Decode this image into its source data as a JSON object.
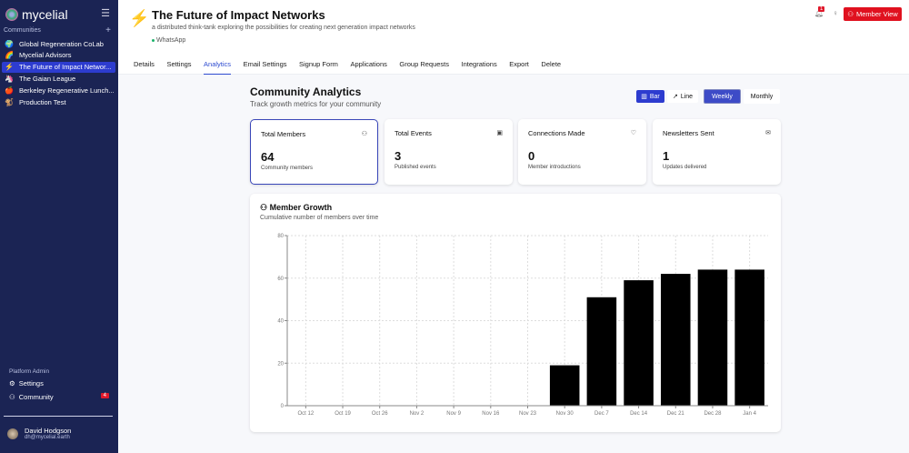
{
  "sidebar": {
    "brand": "mycelial",
    "communities_label": "Communities",
    "items": [
      {
        "icon": "🌍",
        "label": "Global Regeneration CoLab"
      },
      {
        "icon": "🌈",
        "label": "Mycelial Advisors"
      },
      {
        "icon": "⚡",
        "label": "The Future of Impact Networ..."
      },
      {
        "icon": "🦄",
        "label": "The Gaian League"
      },
      {
        "icon": "🍎",
        "label": "Berkeley Regenerative Lunch..."
      },
      {
        "icon": "🐒",
        "label": "Production Test"
      }
    ],
    "platform_admin": "Platform Admin",
    "settings": "Settings",
    "community": "Community",
    "community_badge": "4",
    "user": {
      "name": "David Hodgson",
      "email": "dh@mycelial.earth"
    }
  },
  "header": {
    "title": "The Future of Impact Networks",
    "description": "a distributed think-tank exploring the possibilities for creating next generation impact networks",
    "platform": "WhatsApp",
    "notif_count": "1",
    "member_view": "Member View",
    "tabs": [
      "Details",
      "Settings",
      "Analytics",
      "Email Settings",
      "Signup Form",
      "Applications",
      "Group Requests",
      "Integrations",
      "Export",
      "Delete"
    ],
    "active_tab": "Analytics"
  },
  "analytics": {
    "title": "Community Analytics",
    "subtitle": "Track growth metrics for your community",
    "bar": "Bar",
    "line": "Line",
    "weekly": "Weekly",
    "monthly": "Monthly",
    "cards": [
      {
        "title": "Total Members",
        "value": "64",
        "sub": "Community members",
        "icon": "users-icon"
      },
      {
        "title": "Total Events",
        "value": "3",
        "sub": "Published events",
        "icon": "calendar-icon"
      },
      {
        "title": "Connections Made",
        "value": "0",
        "sub": "Member introductions",
        "icon": "heart-icon"
      },
      {
        "title": "Newsletters Sent",
        "value": "1",
        "sub": "Updates delivered",
        "icon": "mail-icon"
      }
    ]
  },
  "colors": {
    "sidebar": "#1b2454",
    "accent": "#2d3ccf",
    "danger": "#e0111f"
  },
  "chart_data": {
    "type": "bar",
    "title": "Member Growth",
    "subtitle": "Cumulative number of members over time",
    "categories": [
      "Oct 12",
      "Oct 19",
      "Oct 26",
      "Nov 2",
      "Nov 9",
      "Nov 16",
      "Nov 23",
      "Nov 30",
      "Dec 7",
      "Dec 14",
      "Dec 21",
      "Dec 28",
      "Jan 4"
    ],
    "values": [
      0,
      0,
      0,
      0,
      0,
      0,
      0,
      19,
      51,
      59,
      62,
      64,
      64
    ],
    "ylim": [
      0,
      80
    ],
    "yticks": [
      0,
      20,
      40,
      60,
      80
    ],
    "grid": true,
    "bar_color": "#000000"
  }
}
